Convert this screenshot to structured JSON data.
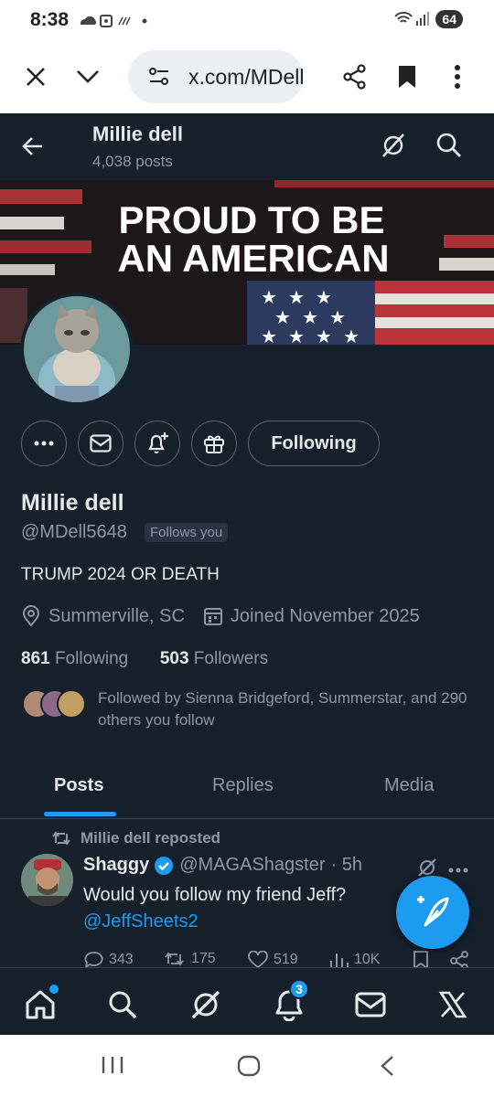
{
  "status_bar": {
    "time": "8:38",
    "battery": "64"
  },
  "browser": {
    "url": "x.com/MDell5648"
  },
  "profile": {
    "name": "Millie dell",
    "post_count": "4,038 posts",
    "handle": "@MDell5648",
    "follows_you": "Follows you",
    "bio": "TRUMP 2024 OR DEATH",
    "location": "Summerville, SC",
    "joined": "Joined November 2025",
    "following_count": "861",
    "following_label": "Following",
    "followers_count": "503",
    "followers_label": "Followers",
    "followed_by": "Followed by Sienna Bridgeford, Summerstar, and 290 others you follow",
    "follow_button": "Following",
    "banner_line1": "PROUD TO BE",
    "banner_line2": "AN AMERICAN"
  },
  "tabs": [
    {
      "label": "Posts",
      "active": true
    },
    {
      "label": "Replies",
      "active": false
    },
    {
      "label": "Media",
      "active": false
    }
  ],
  "post": {
    "repost_label": "Millie dell reposted",
    "author_name": "Shaggy",
    "author_handle": "@MAGAShagster",
    "time": "· 5h",
    "text": "Would you follow my friend Jeff?",
    "mention": "@JeffSheets2",
    "replies": "343",
    "reposts": "175",
    "likes": "519",
    "views": "10K"
  },
  "bottom_nav": {
    "notification_count": "3"
  },
  "colors": {
    "background": "#15202b",
    "accent": "#1d9bf0",
    "muted": "#8b98a5"
  }
}
